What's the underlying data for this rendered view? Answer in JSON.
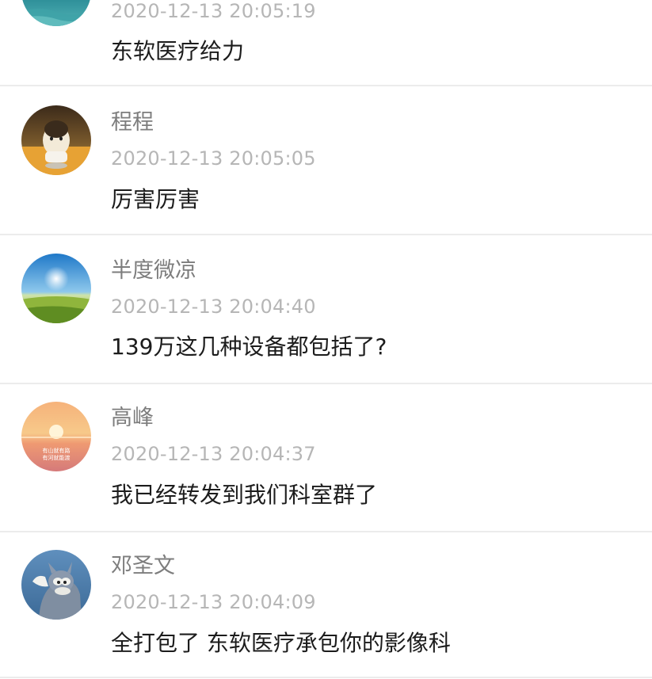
{
  "comments": [
    {
      "username": "",
      "time": "2020-12-13 20:05:19",
      "text": "东软医疗给力",
      "avatar": "ocean-avatar-icon"
    },
    {
      "username": "程程",
      "time": "2020-12-13 20:05:05",
      "text": "厉害厉害",
      "avatar": "crayon-shinchan-figure-avatar-icon"
    },
    {
      "username": "半度微凉",
      "time": "2020-12-13 20:04:40",
      "text": "139万这几种设备都包括了?",
      "avatar": "grassland-sky-avatar-icon"
    },
    {
      "username": "高峰",
      "time": "2020-12-13 20:04:37",
      "text": "我已经转发到我们科室群了",
      "avatar": "sunset-avatar-icon",
      "avatar_caption": [
        "有山就有路",
        "有河就能渡"
      ]
    },
    {
      "username": "邓圣文",
      "time": "2020-12-13 20:04:09",
      "text": "全打包了 东软医疗承包你的影像科",
      "avatar": "tom-cat-avatar-icon"
    }
  ],
  "colors": {
    "username": "#7d7d7d",
    "timestamp": "#b6b6b6",
    "content": "#1c1c1c",
    "divider": "#ececec"
  }
}
